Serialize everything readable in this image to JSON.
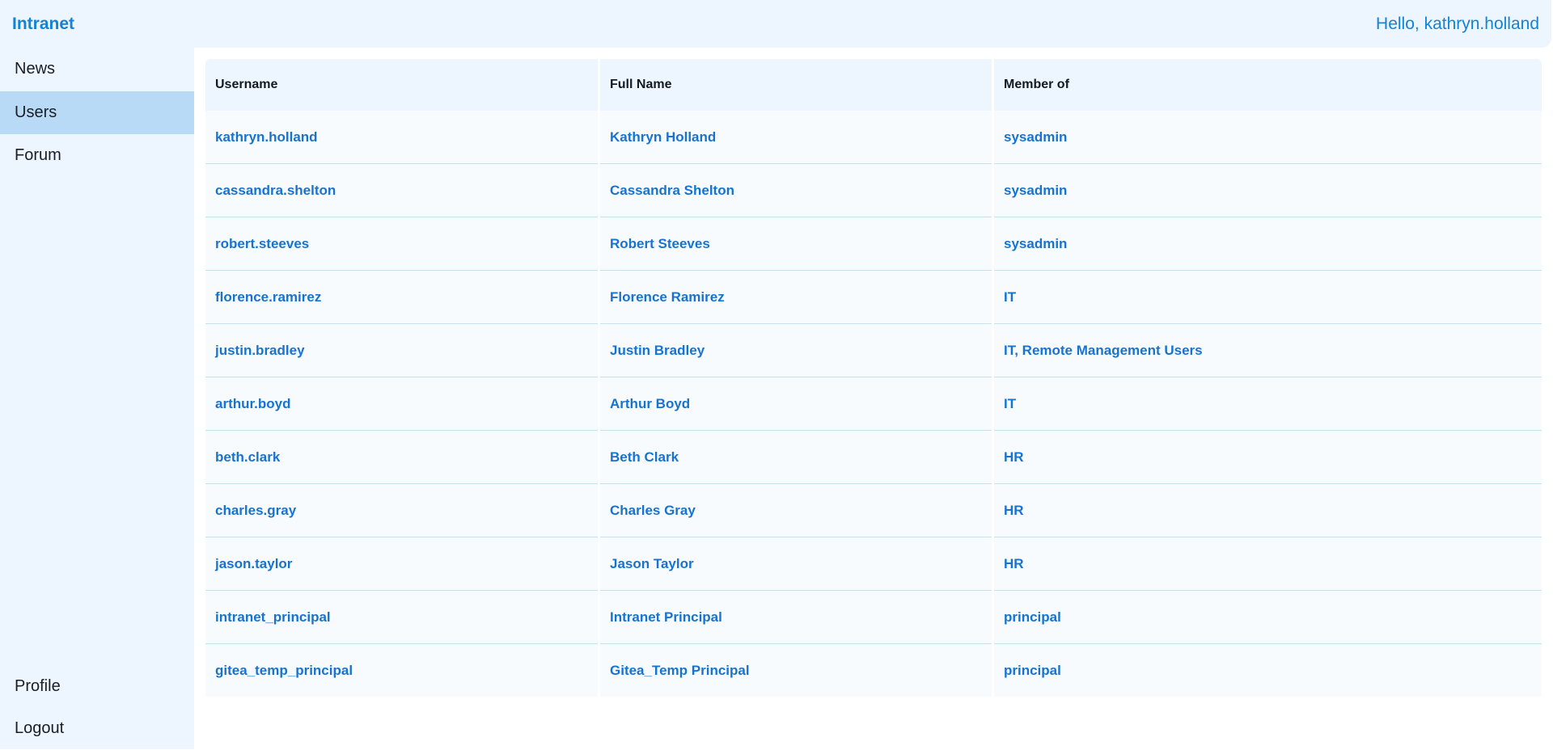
{
  "header": {
    "brand": "Intranet",
    "greeting": "Hello, kathryn.holland"
  },
  "sidebar": {
    "items": [
      {
        "label": "News"
      },
      {
        "label": "Users",
        "active": true
      },
      {
        "label": "Forum"
      }
    ],
    "bottom_items": [
      {
        "label": "Profile"
      },
      {
        "label": "Logout"
      }
    ]
  },
  "table": {
    "columns": [
      "Username",
      "Full Name",
      "Member of"
    ],
    "rows": [
      {
        "username": "kathryn.holland",
        "full_name": "Kathryn Holland",
        "member_of": "sysadmin"
      },
      {
        "username": "cassandra.shelton",
        "full_name": "Cassandra Shelton",
        "member_of": "sysadmin"
      },
      {
        "username": "robert.steeves",
        "full_name": "Robert Steeves",
        "member_of": "sysadmin"
      },
      {
        "username": "florence.ramirez",
        "full_name": "Florence Ramirez",
        "member_of": "IT"
      },
      {
        "username": "justin.bradley",
        "full_name": "Justin Bradley",
        "member_of": "IT, Remote Management Users"
      },
      {
        "username": "arthur.boyd",
        "full_name": "Arthur Boyd",
        "member_of": "IT"
      },
      {
        "username": "beth.clark",
        "full_name": "Beth Clark",
        "member_of": "HR"
      },
      {
        "username": "charles.gray",
        "full_name": "Charles Gray",
        "member_of": "HR"
      },
      {
        "username": "jason.taylor",
        "full_name": "Jason Taylor",
        "member_of": "HR"
      },
      {
        "username": "intranet_principal",
        "full_name": "Intranet Principal",
        "member_of": "principal"
      },
      {
        "username": "gitea_temp_principal",
        "full_name": "Gitea_Temp Principal",
        "member_of": "principal"
      }
    ]
  },
  "colors": {
    "accent": "#1383d6",
    "link": "#1673d0",
    "panel_bg": "#edf5fe",
    "active_nav": "#b8daf6"
  }
}
